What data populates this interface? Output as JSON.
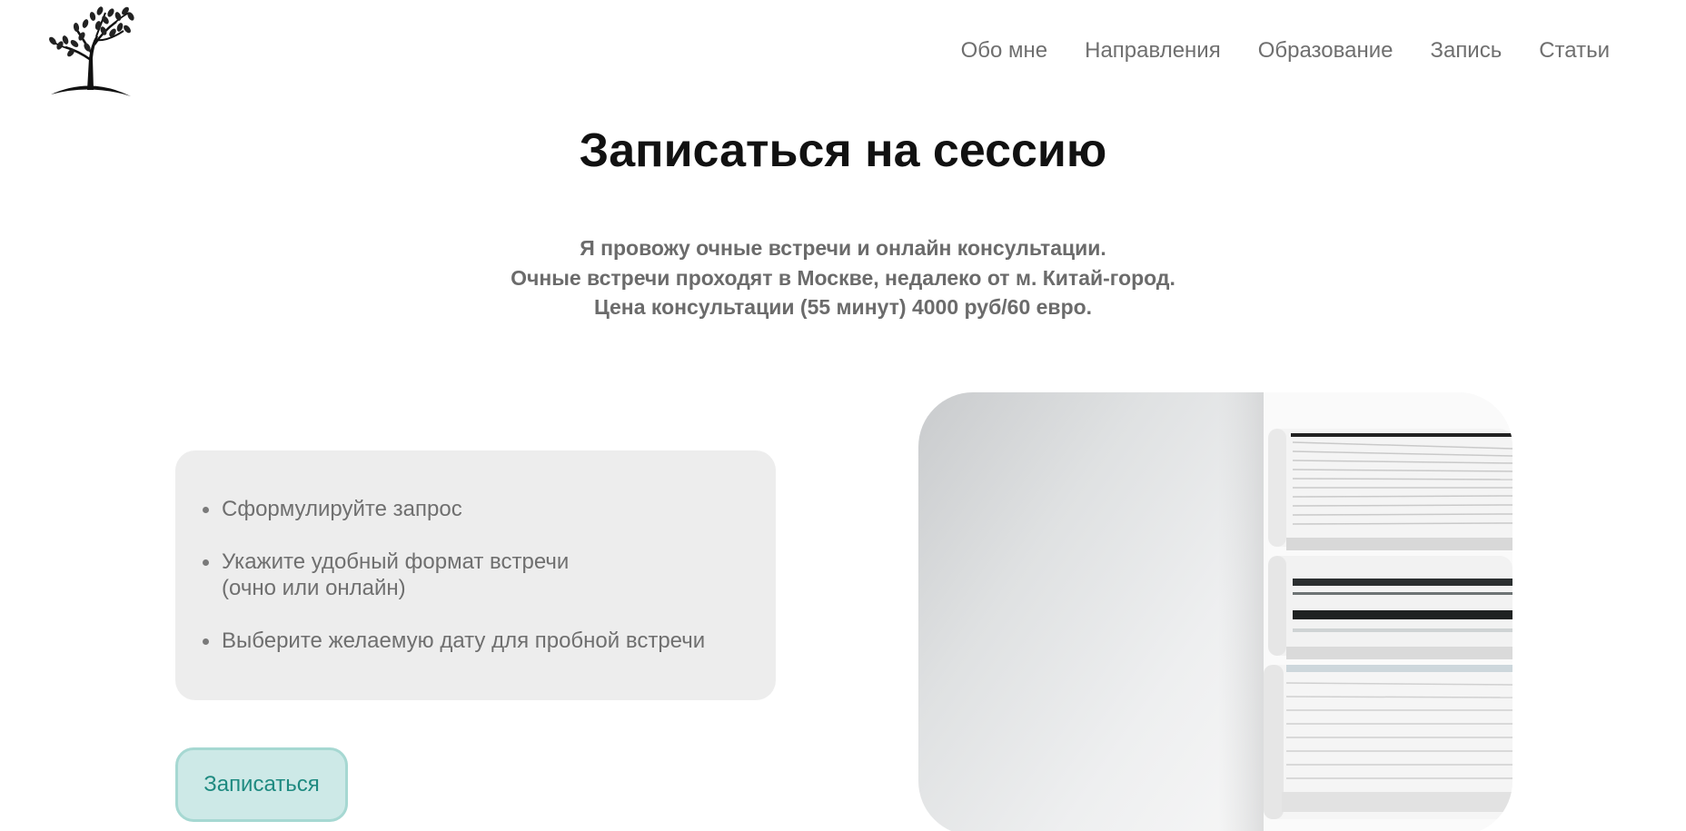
{
  "header": {
    "logo_icon": "tree-icon",
    "nav": [
      {
        "label": "Обо мне"
      },
      {
        "label": "Направления"
      },
      {
        "label": "Образование"
      },
      {
        "label": "Запись"
      },
      {
        "label": "Статьи"
      }
    ]
  },
  "main": {
    "title": "Записаться на сессию",
    "intro_lines": [
      "Я провожу очные встречи и онлайн консультации.",
      "Очные встречи проходят в Москве, недалеко от м. Китай-город.",
      "Цена консультации (55 минут) 4000 руб/60 евро."
    ],
    "steps": [
      {
        "lines": [
          "Сформулируйте запрос"
        ]
      },
      {
        "lines": [
          "Укажите удобный формат встречи",
          "(очно или онлайн)"
        ]
      },
      {
        "lines": [
          "Выберите желаемую дату для пробной встречи"
        ]
      }
    ],
    "signup_button": "Записаться",
    "photo_icon": "stacked-binders-photo"
  },
  "colors": {
    "nav_text": "#6f6f6f",
    "title": "#111111",
    "intro_text": "#6b6b6b",
    "card_bg": "#ededed",
    "button_bg": "#cde9e7",
    "button_border": "#a6d8d2",
    "button_text": "#1e8a80"
  }
}
